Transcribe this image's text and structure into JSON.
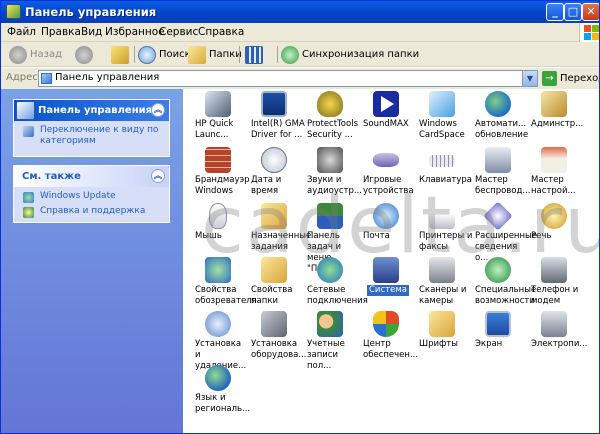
{
  "window": {
    "title": "Панель управления"
  },
  "menu": [
    "Файл",
    "Правка",
    "Вид",
    "Избранное",
    "Сервис",
    "Справка"
  ],
  "toolbar": {
    "back": "Назад",
    "search": "Поиск",
    "folders": "Папки",
    "sync": "Синхронизация папки"
  },
  "address": {
    "label": "Адрес",
    "value": "Панель управления",
    "go": "Переход"
  },
  "sidebar": {
    "panel1": {
      "title": "Панель управления",
      "link": "Переключение к виду по категориям"
    },
    "panel2": {
      "title": "См. также",
      "links": [
        "Windows Update",
        "Справка и поддержка"
      ]
    }
  },
  "items": [
    {
      "label": "HP Quick Launc...",
      "icon": "rocket-icon"
    },
    {
      "label": "Intel(R) GMA Driver for ...",
      "icon": "monitor-icon"
    },
    {
      "label": "ProtectTools Security ...",
      "icon": "shield-icon"
    },
    {
      "label": "SoundMAX",
      "icon": "play-icon"
    },
    {
      "label": "Windows CardSpace",
      "icon": "card-icon"
    },
    {
      "label": "Автомати... обновление",
      "icon": "update-icon"
    },
    {
      "label": "Админстр...",
      "icon": "admin-tools-icon"
    },
    {
      "label": "Брандмауэр Windows",
      "icon": "firewall-icon"
    },
    {
      "label": "Дата и время",
      "icon": "clock-icon"
    },
    {
      "label": "Звуки и аудиоустр...",
      "icon": "speaker-icon"
    },
    {
      "label": "Игровые устройства",
      "icon": "gamepad-icon"
    },
    {
      "label": "Клавиатура",
      "icon": "keyboard-icon"
    },
    {
      "label": "Мастер беспровод...",
      "icon": "wireless-icon"
    },
    {
      "label": "Мастер настрой...",
      "icon": "network-setup-icon"
    },
    {
      "label": "Мышь",
      "icon": "mouse-icon"
    },
    {
      "label": "Назначенные задания",
      "icon": "scheduled-tasks-icon"
    },
    {
      "label": "Панель задач и меню \"Пуск\"",
      "icon": "taskbar-icon"
    },
    {
      "label": "Почта",
      "icon": "mail-icon"
    },
    {
      "label": "Принтеры и факсы",
      "icon": "printer-icon"
    },
    {
      "label": "Расширенные сведения о...",
      "icon": "info-icon"
    },
    {
      "label": "Речь",
      "icon": "speech-icon"
    },
    {
      "label": "Свойства обозревателя",
      "icon": "internet-options-icon"
    },
    {
      "label": "Свойства папки",
      "icon": "folder-options-icon"
    },
    {
      "label": "Сетевые подключения",
      "icon": "network-icon"
    },
    {
      "label": "Система",
      "icon": "system-icon"
    },
    {
      "label": "Сканеры и камеры",
      "icon": "scanner-icon"
    },
    {
      "label": "Специальные возможности",
      "icon": "accessibility-icon"
    },
    {
      "label": "Телефон и модем",
      "icon": "phone-icon"
    },
    {
      "label": "Установка и удаление...",
      "icon": "add-remove-icon"
    },
    {
      "label": "Установка оборудова...",
      "icon": "hardware-icon"
    },
    {
      "label": "Учетные записи пол...",
      "icon": "users-icon"
    },
    {
      "label": "Центр обеспечен...",
      "icon": "security-center-icon"
    },
    {
      "label": "Шрифты",
      "icon": "fonts-icon"
    },
    {
      "label": "Экран",
      "icon": "display-icon"
    },
    {
      "label": "Электропи...",
      "icon": "power-icon"
    },
    {
      "label": "Язык и региональ...",
      "icon": "regional-icon"
    }
  ],
  "watermark": "cadelta.ru"
}
